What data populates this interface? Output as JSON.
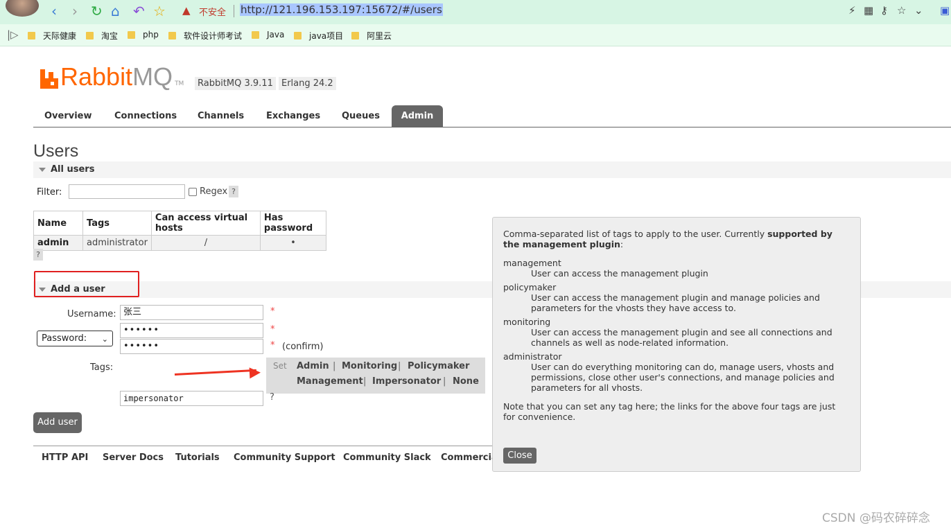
{
  "browser": {
    "insecure_label": "不安全",
    "url": "http://121.196.153.197:15672/#/users",
    "bookmarks": [
      "天际健康",
      "淘宝",
      "php",
      "软件设计师考试",
      "Java",
      "java项目",
      "阿里云"
    ]
  },
  "header": {
    "logo_rabbit": "Rabbit",
    "logo_mq": "MQ",
    "logo_tm": "TM",
    "rabbit_version": "RabbitMQ 3.9.11",
    "erlang_version": "Erlang 24.2"
  },
  "tabs": [
    "Overview",
    "Connections",
    "Channels",
    "Exchanges",
    "Queues",
    "Admin"
  ],
  "page": {
    "title": "Users",
    "all_users_label": "All users",
    "filter_label": "Filter:",
    "regex_label": "Regex",
    "help": "?"
  },
  "users_table": {
    "columns": [
      "Name",
      "Tags",
      "Can access virtual hosts",
      "Has password"
    ],
    "rows": [
      [
        "admin",
        "administrator",
        "/",
        "•"
      ]
    ]
  },
  "add_user": {
    "section_label": "Add a user",
    "username_label": "Username:",
    "username_value": "张三",
    "password_select": "Password:",
    "password_value": "••••••",
    "password_confirm_value": "••••••",
    "confirm_label": "(confirm)",
    "required_mark": "*",
    "tags_label": "Tags:",
    "tags_set_label": "Set",
    "tag_links": [
      "Admin",
      "Monitoring",
      "Policymaker",
      "Management",
      "Impersonator",
      "None"
    ],
    "tag_separator": "|",
    "tags_value": "impersonator",
    "submit_label": "Add user"
  },
  "footer": [
    "HTTP API",
    "Server Docs",
    "Tutorials",
    "Community Support",
    "Community Slack",
    "Commercia"
  ],
  "popup": {
    "intro_normal": "Comma-separated list of tags to apply to the user. Currently ",
    "intro_bold": "supported by the management plugin",
    "intro_end": ":",
    "tags": [
      {
        "name": "management",
        "desc": "User can access the management plugin"
      },
      {
        "name": "policymaker",
        "desc": "User can access the management plugin and manage policies and parameters for the vhosts they have access to."
      },
      {
        "name": "monitoring",
        "desc": "User can access the management plugin and see all connections and channels as well as node-related information."
      },
      {
        "name": "administrator",
        "desc": "User can do everything monitoring can do, manage users, vhosts and permissions, close other user's connections, and manage policies and parameters for all vhosts."
      }
    ],
    "note": "Note that you can set any tag here; the links for the above four tags are just for convenience.",
    "close_label": "Close"
  },
  "watermark": "CSDN @码农碎碎念"
}
